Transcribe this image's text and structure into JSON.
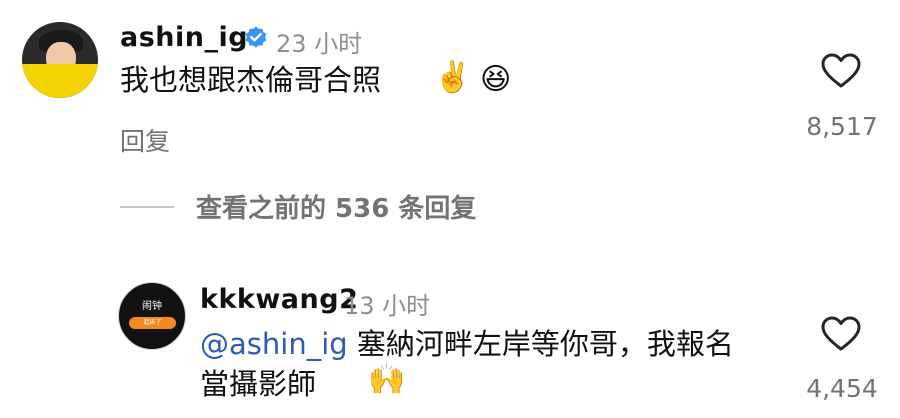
{
  "comments": [
    {
      "username": "ashin_ig",
      "verified": true,
      "time": "23 小时",
      "text": "我也想跟杰倫哥合照",
      "emojis": [
        "✌️",
        "😆"
      ],
      "reply_label": "回复",
      "likes": "8,517",
      "icons": {
        "like": "heart-outline-icon",
        "verified": "verified-badge-icon"
      }
    },
    {
      "username": "kkkwang2",
      "time": "13 小时",
      "mention": "@ashin_ig",
      "text": " 塞納河畔左岸等你哥，我報名當攝影師",
      "emojis": [
        "🙌"
      ],
      "likes": "4,454",
      "avatar_logo_text": "闹钟",
      "avatar_pill_text": "起床了"
    }
  ],
  "view_replies": "查看之前的 536 条回复",
  "colors": {
    "text": "#111111",
    "secondary": "#737373",
    "mention": "#2f5bb5",
    "verified": "#3797f0"
  }
}
